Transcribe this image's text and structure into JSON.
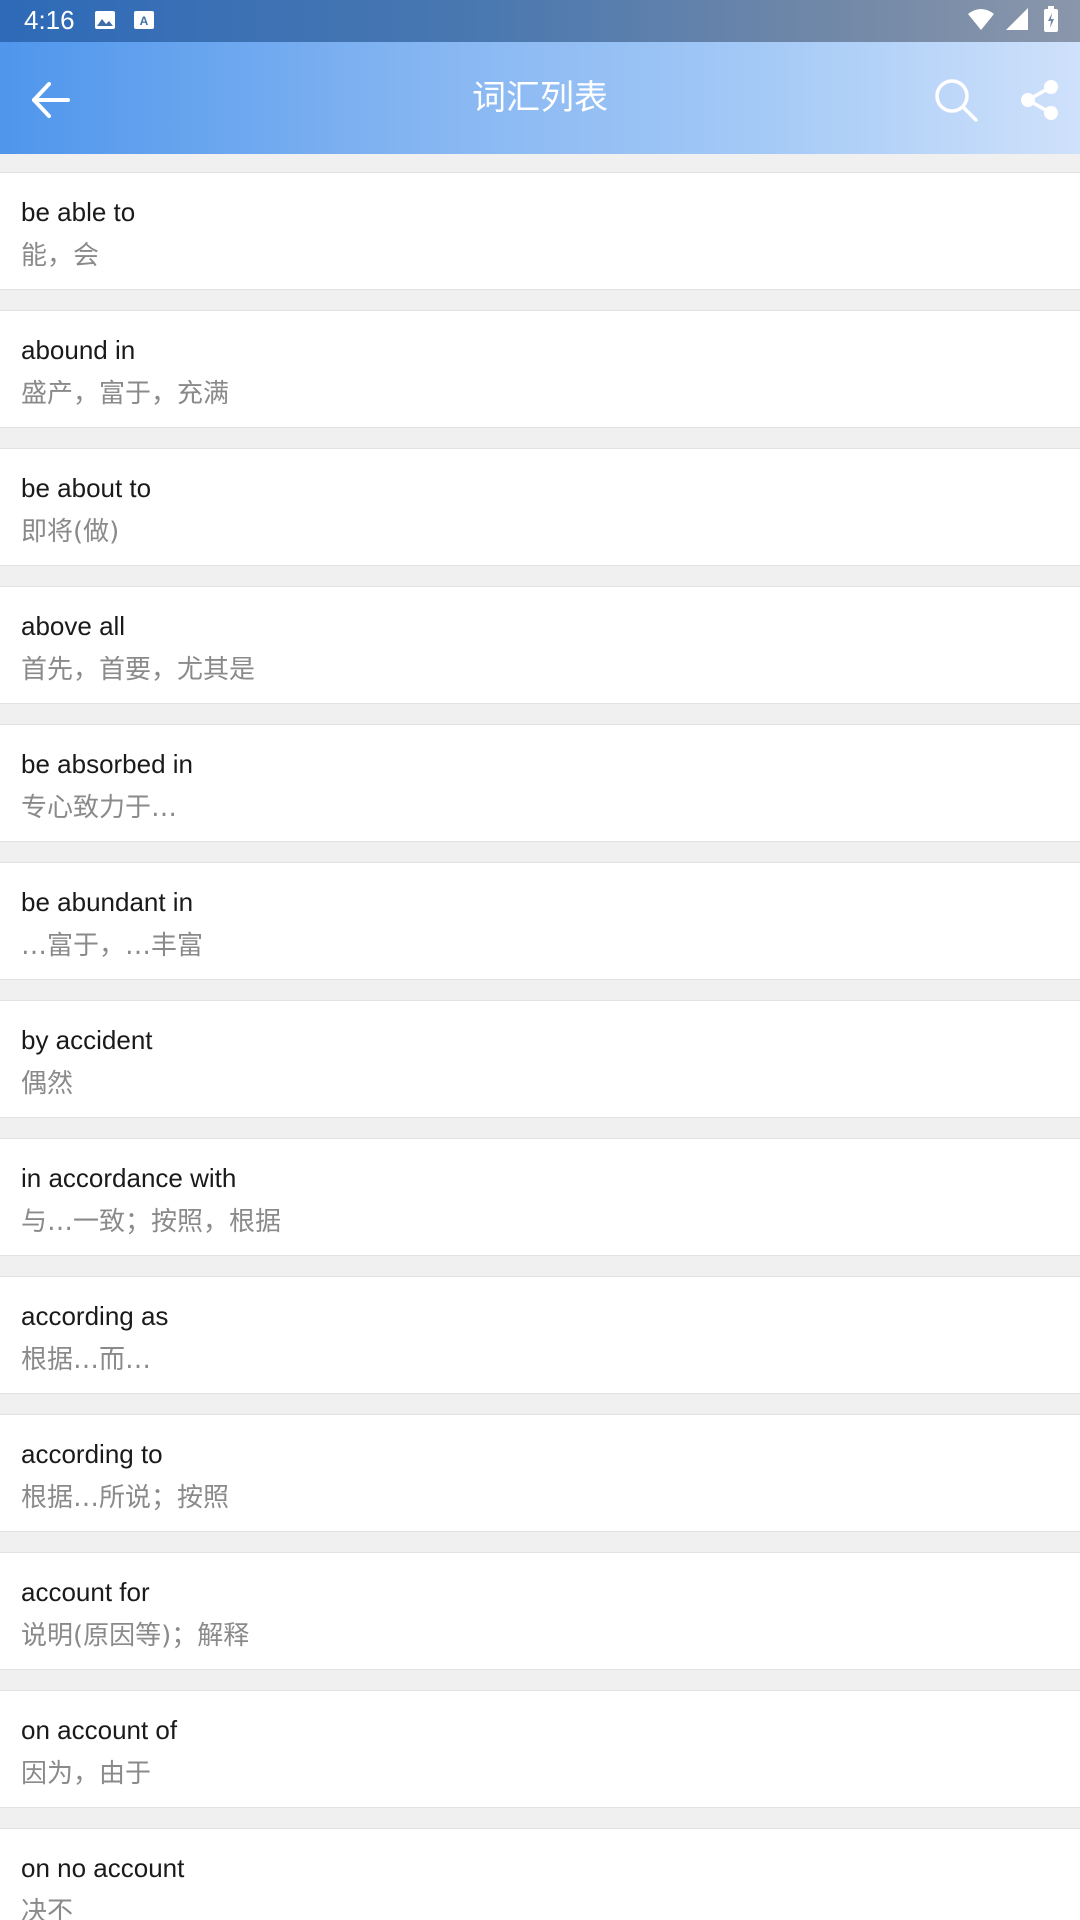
{
  "status_bar": {
    "time": "4:16",
    "icons": [
      "image-icon",
      "a-icon",
      "wifi-icon",
      "signal-icon",
      "battery-icon"
    ]
  },
  "app_bar": {
    "title": "词汇列表",
    "back_icon": "arrow-left-icon",
    "search_icon": "search-icon",
    "share_icon": "share-icon"
  },
  "colors": {
    "app_bar_start": "#4f96ec",
    "app_bar_end": "#cfe1fb",
    "word_text": "#1a1a1a",
    "meaning_text": "#8a8a8a",
    "list_background": "#f0f0f0"
  },
  "vocab_list": [
    {
      "word": "be able to",
      "meaning": "能，会"
    },
    {
      "word": "abound in",
      "meaning": "盛产，富于，充满"
    },
    {
      "word": "be about to",
      "meaning": "即将(做)"
    },
    {
      "word": "above all",
      "meaning": "首先，首要，尤其是"
    },
    {
      "word": "be absorbed in",
      "meaning": "专心致力于…"
    },
    {
      "word": "be abundant in",
      "meaning": "…富于，…丰富"
    },
    {
      "word": "by accident",
      "meaning": "偶然"
    },
    {
      "word": "in accordance with",
      "meaning": "与…一致；按照，根据"
    },
    {
      "word": "according as",
      "meaning": "根据…而…"
    },
    {
      "word": "according to",
      "meaning": "根据…所说；按照"
    },
    {
      "word": "account for",
      "meaning": "说明(原因等)；解释"
    },
    {
      "word": "on account of",
      "meaning": "因为，由于"
    },
    {
      "word": "on no account",
      "meaning": "决不"
    }
  ]
}
